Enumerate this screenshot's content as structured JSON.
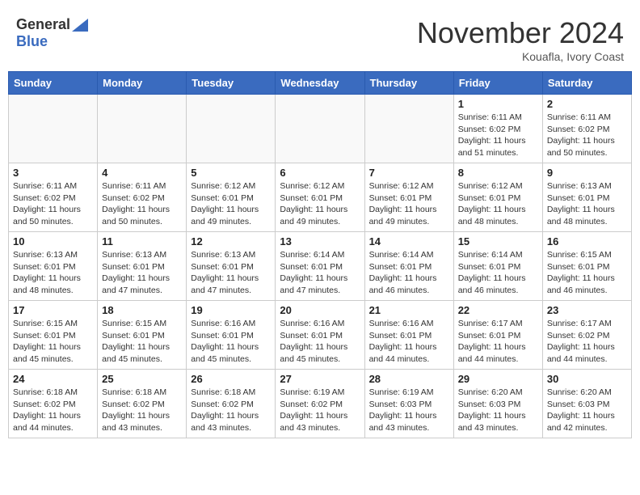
{
  "header": {
    "logo_general": "General",
    "logo_blue": "Blue",
    "month": "November 2024",
    "location": "Kouafla, Ivory Coast"
  },
  "days_of_week": [
    "Sunday",
    "Monday",
    "Tuesday",
    "Wednesday",
    "Thursday",
    "Friday",
    "Saturday"
  ],
  "weeks": [
    {
      "row_class": "row-odd",
      "days": [
        {
          "date": "",
          "info": "",
          "empty": true
        },
        {
          "date": "",
          "info": "",
          "empty": true
        },
        {
          "date": "",
          "info": "",
          "empty": true
        },
        {
          "date": "",
          "info": "",
          "empty": true
        },
        {
          "date": "",
          "info": "",
          "empty": true
        },
        {
          "date": "1",
          "info": "Sunrise: 6:11 AM\nSunset: 6:02 PM\nDaylight: 11 hours\nand 51 minutes.",
          "empty": false
        },
        {
          "date": "2",
          "info": "Sunrise: 6:11 AM\nSunset: 6:02 PM\nDaylight: 11 hours\nand 50 minutes.",
          "empty": false
        }
      ]
    },
    {
      "row_class": "row-even",
      "days": [
        {
          "date": "3",
          "info": "Sunrise: 6:11 AM\nSunset: 6:02 PM\nDaylight: 11 hours\nand 50 minutes.",
          "empty": false
        },
        {
          "date": "4",
          "info": "Sunrise: 6:11 AM\nSunset: 6:02 PM\nDaylight: 11 hours\nand 50 minutes.",
          "empty": false
        },
        {
          "date": "5",
          "info": "Sunrise: 6:12 AM\nSunset: 6:01 PM\nDaylight: 11 hours\nand 49 minutes.",
          "empty": false
        },
        {
          "date": "6",
          "info": "Sunrise: 6:12 AM\nSunset: 6:01 PM\nDaylight: 11 hours\nand 49 minutes.",
          "empty": false
        },
        {
          "date": "7",
          "info": "Sunrise: 6:12 AM\nSunset: 6:01 PM\nDaylight: 11 hours\nand 49 minutes.",
          "empty": false
        },
        {
          "date": "8",
          "info": "Sunrise: 6:12 AM\nSunset: 6:01 PM\nDaylight: 11 hours\nand 48 minutes.",
          "empty": false
        },
        {
          "date": "9",
          "info": "Sunrise: 6:13 AM\nSunset: 6:01 PM\nDaylight: 11 hours\nand 48 minutes.",
          "empty": false
        }
      ]
    },
    {
      "row_class": "row-odd",
      "days": [
        {
          "date": "10",
          "info": "Sunrise: 6:13 AM\nSunset: 6:01 PM\nDaylight: 11 hours\nand 48 minutes.",
          "empty": false
        },
        {
          "date": "11",
          "info": "Sunrise: 6:13 AM\nSunset: 6:01 PM\nDaylight: 11 hours\nand 47 minutes.",
          "empty": false
        },
        {
          "date": "12",
          "info": "Sunrise: 6:13 AM\nSunset: 6:01 PM\nDaylight: 11 hours\nand 47 minutes.",
          "empty": false
        },
        {
          "date": "13",
          "info": "Sunrise: 6:14 AM\nSunset: 6:01 PM\nDaylight: 11 hours\nand 47 minutes.",
          "empty": false
        },
        {
          "date": "14",
          "info": "Sunrise: 6:14 AM\nSunset: 6:01 PM\nDaylight: 11 hours\nand 46 minutes.",
          "empty": false
        },
        {
          "date": "15",
          "info": "Sunrise: 6:14 AM\nSunset: 6:01 PM\nDaylight: 11 hours\nand 46 minutes.",
          "empty": false
        },
        {
          "date": "16",
          "info": "Sunrise: 6:15 AM\nSunset: 6:01 PM\nDaylight: 11 hours\nand 46 minutes.",
          "empty": false
        }
      ]
    },
    {
      "row_class": "row-even",
      "days": [
        {
          "date": "17",
          "info": "Sunrise: 6:15 AM\nSunset: 6:01 PM\nDaylight: 11 hours\nand 45 minutes.",
          "empty": false
        },
        {
          "date": "18",
          "info": "Sunrise: 6:15 AM\nSunset: 6:01 PM\nDaylight: 11 hours\nand 45 minutes.",
          "empty": false
        },
        {
          "date": "19",
          "info": "Sunrise: 6:16 AM\nSunset: 6:01 PM\nDaylight: 11 hours\nand 45 minutes.",
          "empty": false
        },
        {
          "date": "20",
          "info": "Sunrise: 6:16 AM\nSunset: 6:01 PM\nDaylight: 11 hours\nand 45 minutes.",
          "empty": false
        },
        {
          "date": "21",
          "info": "Sunrise: 6:16 AM\nSunset: 6:01 PM\nDaylight: 11 hours\nand 44 minutes.",
          "empty": false
        },
        {
          "date": "22",
          "info": "Sunrise: 6:17 AM\nSunset: 6:01 PM\nDaylight: 11 hours\nand 44 minutes.",
          "empty": false
        },
        {
          "date": "23",
          "info": "Sunrise: 6:17 AM\nSunset: 6:02 PM\nDaylight: 11 hours\nand 44 minutes.",
          "empty": false
        }
      ]
    },
    {
      "row_class": "row-odd",
      "days": [
        {
          "date": "24",
          "info": "Sunrise: 6:18 AM\nSunset: 6:02 PM\nDaylight: 11 hours\nand 44 minutes.",
          "empty": false
        },
        {
          "date": "25",
          "info": "Sunrise: 6:18 AM\nSunset: 6:02 PM\nDaylight: 11 hours\nand 43 minutes.",
          "empty": false
        },
        {
          "date": "26",
          "info": "Sunrise: 6:18 AM\nSunset: 6:02 PM\nDaylight: 11 hours\nand 43 minutes.",
          "empty": false
        },
        {
          "date": "27",
          "info": "Sunrise: 6:19 AM\nSunset: 6:02 PM\nDaylight: 11 hours\nand 43 minutes.",
          "empty": false
        },
        {
          "date": "28",
          "info": "Sunrise: 6:19 AM\nSunset: 6:03 PM\nDaylight: 11 hours\nand 43 minutes.",
          "empty": false
        },
        {
          "date": "29",
          "info": "Sunrise: 6:20 AM\nSunset: 6:03 PM\nDaylight: 11 hours\nand 43 minutes.",
          "empty": false
        },
        {
          "date": "30",
          "info": "Sunrise: 6:20 AM\nSunset: 6:03 PM\nDaylight: 11 hours\nand 42 minutes.",
          "empty": false
        }
      ]
    }
  ]
}
